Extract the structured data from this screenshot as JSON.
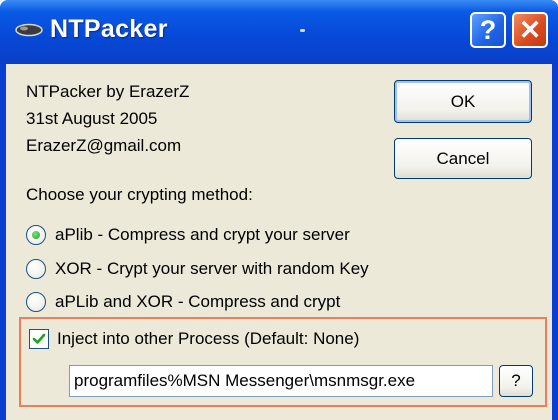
{
  "window": {
    "title": "NTPacker",
    "help_label": "?",
    "close_label": "✕"
  },
  "info": {
    "line1": "NTPacker by ErazerZ",
    "line2": "31st August 2005",
    "line3": "ErazerZ@gmail.com"
  },
  "buttons": {
    "ok": "OK",
    "cancel": "Cancel",
    "browse": "?"
  },
  "crypt": {
    "label": "Choose your crypting method:",
    "options": [
      {
        "label": "aPlib - Compress and crypt your server",
        "selected": true
      },
      {
        "label": "XOR - Crypt your server with random Key",
        "selected": false
      },
      {
        "label": "aPLib and XOR - Compress and crypt",
        "selected": false
      }
    ]
  },
  "inject": {
    "label": "Inject into other Process (Default: None)",
    "checked": true,
    "path_value": "programfiles%MSN Messenger\\msnmsgr.exe"
  },
  "colors": {
    "titlebar": "#0a5ae6",
    "client": "#ece9d8",
    "highlight_border": "#e8805a"
  }
}
